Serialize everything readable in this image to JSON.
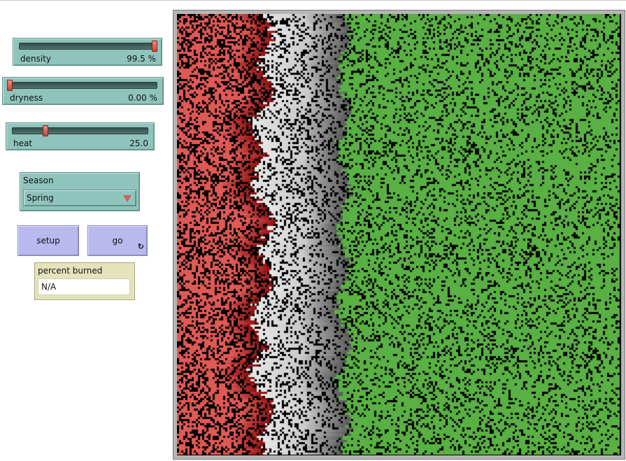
{
  "sliders": [
    {
      "label": "density",
      "value": "99.5 %",
      "fraction": 0.995
    },
    {
      "label": "dryness",
      "value": "0.00 %",
      "fraction": 0.0
    },
    {
      "label": "heat",
      "value": "25.0",
      "fraction": 0.25
    }
  ],
  "chooser": {
    "label": "Season",
    "selected": "Spring"
  },
  "buttons": {
    "setup": "setup",
    "go": "go",
    "go_forever_icon": "↻"
  },
  "monitor": {
    "label": "percent burned",
    "value": "N/A"
  },
  "world": {
    "colors": {
      "burned_red": "#e05a55",
      "burning_dark_red": "#8a0f0f",
      "ash_white": "#e8e8e8",
      "ash_gray": "#5a5a5a",
      "tree_green": "#59b143",
      "empty_black": "#000000"
    },
    "icons": [
      "forever-icon",
      "dropdown-arrow-icon"
    ]
  }
}
